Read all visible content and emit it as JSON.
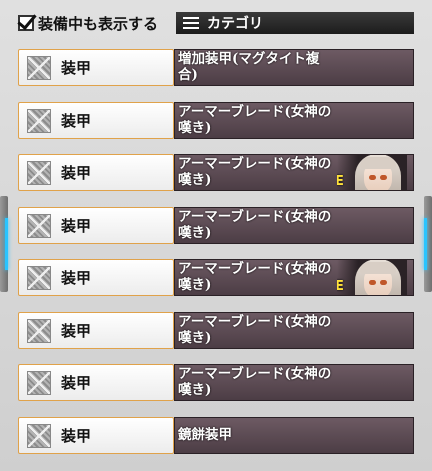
{
  "topbar": {
    "show_equipped_label": "装備中も表示する",
    "show_equipped_checked": true,
    "category_label": "カテゴリ"
  },
  "items": [
    {
      "type": "装甲",
      "name": "増加装甲(マグタイト複合)",
      "equipped_by_character": false
    },
    {
      "type": "装甲",
      "name": "アーマーブレード(女神の嘆き)",
      "equipped_by_character": false
    },
    {
      "type": "装甲",
      "name": "アーマーブレード(女神の嘆き)",
      "equipped_by_character": true,
      "badge": "E"
    },
    {
      "type": "装甲",
      "name": "アーマーブレード(女神の嘆き)",
      "equipped_by_character": false
    },
    {
      "type": "装甲",
      "name": "アーマーブレード(女神の嘆き)",
      "equipped_by_character": true,
      "badge": "E"
    },
    {
      "type": "装甲",
      "name": "アーマーブレード(女神の嘆き)",
      "equipped_by_character": false
    },
    {
      "type": "装甲",
      "name": "アーマーブレード(女神の嘆き)",
      "equipped_by_character": false
    },
    {
      "type": "装甲",
      "name": "鏡餅装甲",
      "equipped_by_character": false
    }
  ]
}
